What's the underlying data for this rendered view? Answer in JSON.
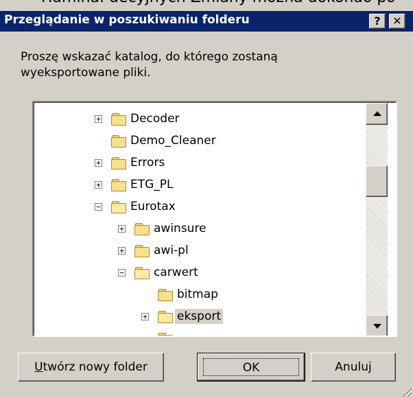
{
  "background_text": "Hamina. decyjnych Zmiany mozna dokonao po",
  "dialog": {
    "title": "Przeglądanie w poszukiwaniu folderu",
    "help_label": "?",
    "close_label": "✕",
    "prompt": "Proszę wskazać katalog, do którego zostaną wyeksportowane pliki."
  },
  "tree": {
    "items": [
      {
        "label": "Decoder",
        "expander": "+",
        "selected": false
      },
      {
        "label": "Demo_Cleaner",
        "expander": "",
        "selected": false
      },
      {
        "label": "Errors",
        "expander": "+",
        "selected": false
      },
      {
        "label": "ETG_PL",
        "expander": "+",
        "selected": false
      },
      {
        "label": "Eurotax",
        "expander": "−",
        "selected": false
      },
      {
        "label": "awinsure",
        "expander": "+",
        "selected": false
      },
      {
        "label": "awi-pl",
        "expander": "+",
        "selected": false
      },
      {
        "label": "carwert",
        "expander": "−",
        "selected": false
      },
      {
        "label": "bitmap",
        "expander": "",
        "selected": false
      },
      {
        "label": "eksport",
        "expander": "+",
        "selected": true
      }
    ]
  },
  "buttons": {
    "new_folder_underlined": "U",
    "new_folder_rest": "twórz nowy folder",
    "ok": "OK",
    "cancel": "Anuluj"
  }
}
